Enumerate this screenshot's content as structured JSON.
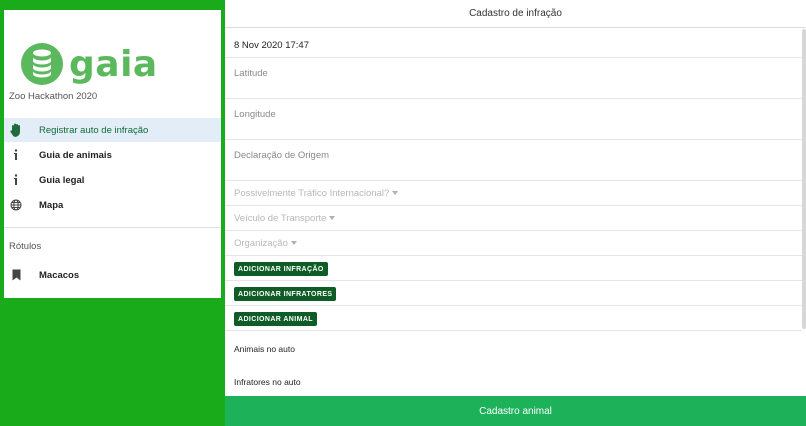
{
  "brand": {
    "name": "gaia",
    "subtitle": "Zoo Hackathon 2020",
    "color": "#5cb85c"
  },
  "drawer": {
    "nav": [
      {
        "label": "Registrar auto de infração",
        "icon": "hand-icon",
        "active": true
      },
      {
        "label": "Guia de animais",
        "icon": "info-icon"
      },
      {
        "label": "Guia legal",
        "icon": "info-icon"
      },
      {
        "label": "Mapa",
        "icon": "globe-icon"
      }
    ],
    "labels_heading": "Rótulos",
    "labels": [
      {
        "label": "Macacos",
        "icon": "bookmark-icon"
      }
    ]
  },
  "main": {
    "title": "Cadastro de infração",
    "datetime": "8 Nov 2020 17:47",
    "fields": {
      "latitude_placeholder": "Latitude",
      "longitude_placeholder": "Longitude",
      "origin_placeholder": "Declaração de Origem"
    },
    "dropdowns": [
      "Possivelmente Tráfico Internacional?",
      "Veículo de Transporte",
      "Organização"
    ],
    "buttons": {
      "add_infraction": "ADICIONAR INFRAÇÃO",
      "add_offenders": "ADICIONAR INFRATORES",
      "add_animal": "ADICIONAR ANIMAL"
    },
    "sections": {
      "animals": "Animais no auto",
      "offenders": "Infratores no auto"
    },
    "bottom_action": "Cadastro animal"
  },
  "colors": {
    "left_background": "#1aab1a",
    "active_nav_bg": "#e3edf8",
    "button_bg": "#0f5c27",
    "bottom_bar": "#1db15a"
  }
}
